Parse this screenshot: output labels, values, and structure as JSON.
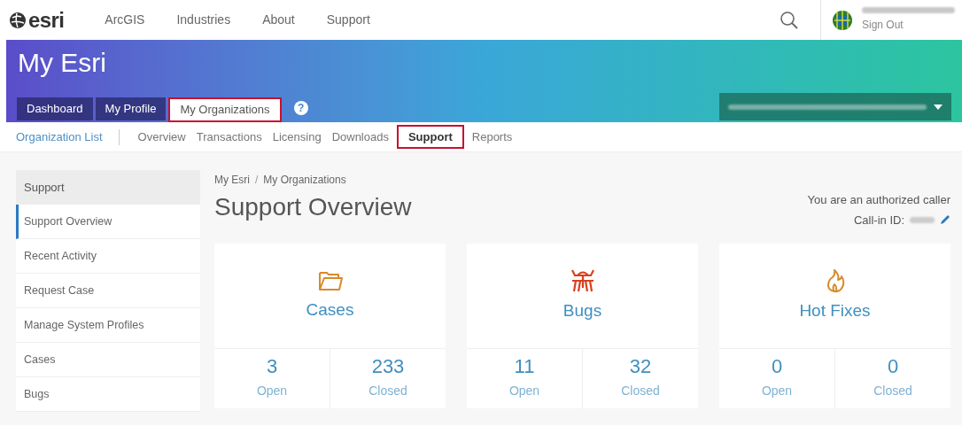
{
  "top_nav": {
    "logo": "esri",
    "items": [
      {
        "label": "ArcGIS"
      },
      {
        "label": "Industries"
      },
      {
        "label": "About"
      },
      {
        "label": "Support"
      }
    ],
    "sign_out": "Sign Out"
  },
  "banner": {
    "title": "My Esri",
    "tabs": [
      {
        "label": "Dashboard",
        "selected": false,
        "highlighted": false
      },
      {
        "label": "My Profile",
        "selected": false,
        "highlighted": false
      },
      {
        "label": "My Organizations",
        "selected": true,
        "highlighted": true
      }
    ],
    "help": "?"
  },
  "sub_nav": {
    "first": "Organization List",
    "items": [
      {
        "label": "Overview",
        "selected": false,
        "highlighted": false
      },
      {
        "label": "Transactions",
        "selected": false,
        "highlighted": false
      },
      {
        "label": "Licensing",
        "selected": false,
        "highlighted": false
      },
      {
        "label": "Downloads",
        "selected": false,
        "highlighted": false
      },
      {
        "label": "Support",
        "selected": true,
        "highlighted": true
      },
      {
        "label": "Reports",
        "selected": false,
        "highlighted": false
      }
    ]
  },
  "sidebar": {
    "heading": "Support",
    "items": [
      {
        "label": "Support Overview",
        "selected": true
      },
      {
        "label": "Recent Activity",
        "selected": false
      },
      {
        "label": "Request Case",
        "selected": false
      },
      {
        "label": "Manage System Profiles",
        "selected": false
      },
      {
        "label": "Cases",
        "selected": false
      },
      {
        "label": "Bugs",
        "selected": false
      }
    ]
  },
  "breadcrumb": {
    "items": [
      "My Esri",
      "My Organizations"
    ],
    "separator": "/"
  },
  "page_title": "Support Overview",
  "caller": {
    "status": "You are an authorized caller",
    "id_label": "Call-in ID:"
  },
  "cards": [
    {
      "kind": "folder",
      "title": "Cases",
      "stats": [
        {
          "value": "3",
          "label": "Open"
        },
        {
          "value": "233",
          "label": "Closed"
        }
      ]
    },
    {
      "kind": "bug",
      "title": "Bugs",
      "stats": [
        {
          "value": "11",
          "label": "Open"
        },
        {
          "value": "32",
          "label": "Closed"
        }
      ]
    },
    {
      "kind": "flame",
      "title": "Hot Fixes",
      "stats": [
        {
          "value": "0",
          "label": "Open"
        },
        {
          "value": "0",
          "label": "Closed"
        }
      ]
    }
  ]
}
